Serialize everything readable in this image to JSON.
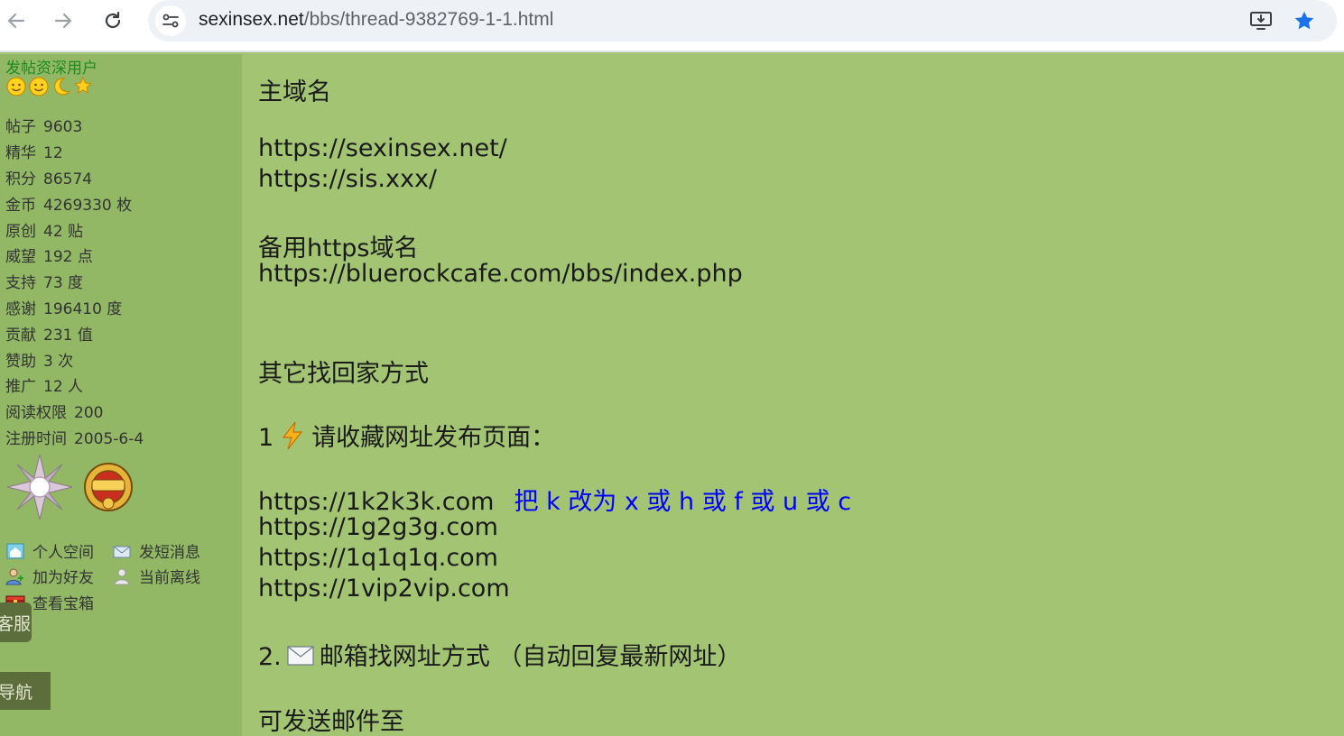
{
  "browser": {
    "url_host": "sexinsex.net",
    "url_path": "/bbs/thread-9382769-1-1.html",
    "icons": [
      "back-icon",
      "forward-icon",
      "reload-icon",
      "site-info-icon",
      "install-app-icon",
      "bookmark-star-icon"
    ]
  },
  "user": {
    "rank": "发帖资深用户",
    "stats": [
      {
        "label": "帖子",
        "value": "9603"
      },
      {
        "label": "精华",
        "value": "12"
      },
      {
        "label": "积分",
        "value": "86574"
      },
      {
        "label": "金币",
        "value": "4269330 枚"
      },
      {
        "label": "原创",
        "value": "42 贴"
      },
      {
        "label": "威望",
        "value": "192 点"
      },
      {
        "label": "支持",
        "value": "73 度"
      },
      {
        "label": "感谢",
        "value": "196410 度"
      },
      {
        "label": "贡献",
        "value": "231 值"
      },
      {
        "label": "赞助",
        "value": "3 次"
      },
      {
        "label": "推广",
        "value": "12 人"
      },
      {
        "label": "阅读权限",
        "value": "200"
      },
      {
        "label": "注册时间",
        "value": "2005-6-4"
      }
    ],
    "actions": {
      "space": "个人空间",
      "message": "发短消息",
      "add_friend": "加为好友",
      "status": "当前离线",
      "treasure": "查看宝箱"
    },
    "float_service": "客服",
    "float_nav": "导航"
  },
  "post": {
    "h_main_domain": "主域名",
    "domain1": "https://sexinsex.net/",
    "domain2": "https://sis.xxx/",
    "h_backup": "备用https域名",
    "backup1": "https://bluerockcafe.com/bbs/index.php",
    "h_other": "其它找回家方式",
    "step1_num": "1",
    "step1_text": "请收藏网址发布页面：",
    "link1": "https://1k2k3k.com",
    "link1_note": "把 k 改为 x 或 h 或 f 或 u 或 c",
    "link2": "https://1g2g3g.com",
    "link3": "https://1q1q1q.com",
    "link4": "https://1vip2vip.com",
    "step2_num": "2.",
    "step2_text": "邮箱找网址方式 （自动回复最新网址）",
    "send_to": "可发送邮件至"
  },
  "colors": {
    "page_bg": "#a3c573",
    "sidebar_bg": "#92b866",
    "rank_green": "#1f8a1f",
    "link_blue": "#0000ff"
  }
}
